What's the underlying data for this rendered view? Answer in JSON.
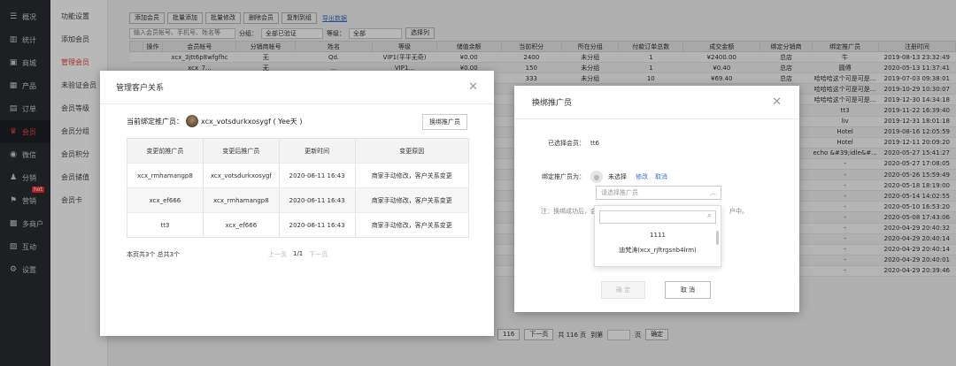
{
  "sidebar": {
    "items": [
      {
        "label": "概况",
        "icon": "dashboard-icon"
      },
      {
        "label": "统计",
        "icon": "chart-icon"
      },
      {
        "label": "商城",
        "icon": "store-icon"
      },
      {
        "label": "产品",
        "icon": "product-icon"
      },
      {
        "label": "订单",
        "icon": "order-icon"
      },
      {
        "label": "会员",
        "icon": "crown-icon"
      },
      {
        "label": "微信",
        "icon": "wechat-icon"
      },
      {
        "label": "分销",
        "icon": "distribution-icon"
      },
      {
        "label": "营销",
        "icon": "flag-icon",
        "badge": "hot"
      },
      {
        "label": "多商户",
        "icon": "merchant-icon"
      },
      {
        "label": "互动",
        "icon": "interact-icon"
      },
      {
        "label": "设置",
        "icon": "gear-icon"
      }
    ]
  },
  "subnav": {
    "items": [
      "功能设置",
      "添加会员",
      "管理会员",
      "未验证会员",
      "会员等级",
      "会员分组",
      "会员积分",
      "会员储值",
      "会员卡"
    ]
  },
  "toolbar": {
    "buttons": [
      "添加会员",
      "批量添加",
      "批量修改",
      "删除会员",
      "复制到组"
    ],
    "export_label": "导出数据"
  },
  "filter": {
    "search_placeholder": "输入会员帐号、手机号、姓名等",
    "group_label": "分组：",
    "group_value": "全部已验证",
    "level_label": "等级：",
    "level_value": "全部",
    "filter_button": "选择列"
  },
  "grid": {
    "headers": [
      "",
      "操作",
      "会员帐号",
      "分销商帐号",
      "姓名",
      "等级",
      "储值余额",
      "当前积分",
      "所在分组",
      "付款订单总数",
      "成交金额",
      "绑定分销商",
      "绑定推广员",
      "注册时间"
    ],
    "rows": [
      [
        "",
        "",
        "xcx_3jtt6p8wfgfhc",
        "无",
        "Qd.",
        "VIP1(平平无奇)",
        "¥0.00",
        "2400",
        "未分组",
        "1",
        "¥2400.00",
        "总店",
        "牛",
        "2019-08-13 23:32:49"
      ],
      [
        "",
        "",
        "xcx_7...",
        "无",
        "...",
        "VIP1...",
        "¥0.00",
        "150",
        "未分组",
        "1",
        "¥0.40",
        "总店",
        "圆傅",
        "2020-05-13 11:37:41"
      ],
      [
        "",
        "",
        "",
        "",
        "",
        "",
        "",
        "333",
        "未分组",
        "10",
        "¥69.40",
        "总店",
        "哈哈哈这个可是可是...",
        "2019-07-03 09:38:01"
      ],
      [
        "",
        "",
        "",
        "",
        "",
        "",
        "",
        "",
        "",
        "",
        "",
        "",
        "哈哈哈这个可是可是...",
        "2019-10-29 10:30:07"
      ],
      [
        "",
        "",
        "",
        "",
        "",
        "",
        "",
        "",
        "",
        "",
        "",
        "",
        "哈哈哈这个可是可是...",
        "2019-12-30 14:34:18"
      ],
      [
        "",
        "",
        "",
        "",
        "",
        "",
        "",
        "",
        "",
        "",
        "",
        "",
        "tt3",
        "2019-11-22 16:39:40"
      ],
      [
        "",
        "",
        "",
        "",
        "",
        "",
        "",
        "",
        "",
        "",
        "",
        "",
        "liv",
        "2019-12-31 18:01:18"
      ],
      [
        "",
        "",
        "",
        "",
        "",
        "",
        "",
        "",
        "",
        "",
        "",
        "",
        "Hotel",
        "2019-08-16 12:05:59"
      ],
      [
        "",
        "",
        "",
        "",
        "",
        "",
        "",
        "",
        "",
        "",
        "",
        "",
        "Hotel",
        "2019-12-11 20:09:20"
      ],
      [
        "",
        "",
        "",
        "",
        "",
        "",
        "",
        "",
        "",
        "",
        "",
        "",
        "echo &#39;idle&#...",
        "2020-05-27 15:41:27"
      ],
      [
        "",
        "",
        "",
        "",
        "",
        "",
        "",
        "",
        "",
        "",
        "",
        "",
        "-",
        "2020-05-27 17:08:05"
      ],
      [
        "",
        "",
        "",
        "",
        "",
        "",
        "",
        "",
        "",
        "",
        "",
        "",
        "-",
        "2020-05-26 15:59:49"
      ],
      [
        "",
        "",
        "",
        "",
        "",
        "",
        "",
        "",
        "",
        "",
        "",
        "",
        "-",
        "2020-05-18 18:19:00"
      ],
      [
        "",
        "",
        "",
        "",
        "",
        "",
        "",
        "",
        "",
        "",
        "",
        "",
        "-",
        "2020-05-14 14:02:55"
      ],
      [
        "",
        "",
        "",
        "",
        "",
        "",
        "",
        "",
        "",
        "",
        "",
        "",
        "-",
        "2020-05-10 16:53:20"
      ],
      [
        "",
        "",
        "",
        "",
        "",
        "",
        "",
        "",
        "",
        "",
        "",
        "",
        "-",
        "2020-05-08 17:43:06"
      ],
      [
        "",
        "",
        "",
        "",
        "",
        "",
        "",
        "",
        "",
        "",
        "",
        "",
        "-",
        "2020-04-29 20:40:32"
      ],
      [
        "",
        "",
        "",
        "",
        "",
        "",
        "",
        "",
        "",
        "",
        "",
        "",
        "-",
        "2020-04-29 20:40:14"
      ],
      [
        "",
        "",
        "",
        "",
        "",
        "",
        "",
        "",
        "",
        "",
        "",
        "",
        "-",
        "2020-04-29 20:40:14"
      ],
      [
        "",
        "",
        "",
        "",
        "",
        "",
        "",
        "",
        "",
        "",
        "",
        "",
        "-",
        "2020-04-29 20:40:01"
      ],
      [
        "",
        "",
        "",
        "",
        "",
        "",
        "",
        "",
        "",
        "",
        "",
        "",
        "-",
        "2020-04-29 20:39:46"
      ]
    ]
  },
  "pager": {
    "page_btn": "116",
    "next": "下一页",
    "total": "共 116 页",
    "goto_label": "到第",
    "page_unit": "页",
    "confirm": "确定"
  },
  "modal1": {
    "title": "管理客户关系",
    "current_label": "当前绑定推广员：",
    "current_value": "xcx_votsdurkxosygf ( Yee天 )",
    "swap_button": "换绑推广员",
    "headers": [
      "变更前推广员",
      "变更后推广员",
      "更新时间",
      "变更原因"
    ],
    "rows": [
      [
        "xcx_rmhamangp8",
        "xcx_votsdurkxosygf",
        "2020-06-11 16:43",
        "商家手动修改，客户关系变更"
      ],
      [
        "xcx_ef666",
        "xcx_rmhamangp8",
        "2020-06-11 16:43",
        "商家手动修改，客户关系变更"
      ],
      [
        "tt3",
        "xcx_ef666",
        "2020-06-11 16:43",
        "商家手动修改，客户关系变更"
      ]
    ],
    "footer": "本页共3个  总共3个",
    "prev": "上一页",
    "page": "1/1",
    "next": "下一页"
  },
  "modal2": {
    "title": "换绑推广员",
    "member_label": "已选择会员：",
    "member_value": "tt6",
    "promoter_label": "绑定推广员为：",
    "promoter_value": "未选择",
    "edit_link": "修改",
    "cancel_link": "取消",
    "select_placeholder": "请选择推广员",
    "note_start": "注：换绑成功后，会",
    "note_end": "户中。",
    "options": [
      "1111",
      "迪梵涛(xcx_rjftrgsnb4lrm)",
      "..."
    ],
    "confirm": "确 定",
    "cancel": "取 消"
  }
}
